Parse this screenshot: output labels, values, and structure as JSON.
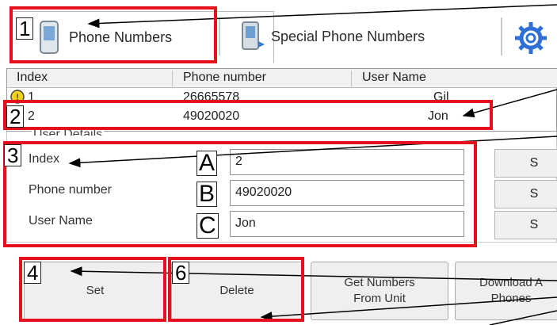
{
  "tabs": [
    {
      "label": "Phone Numbers",
      "icon": "phone-device-icon"
    },
    {
      "label": "Special Phone Numbers",
      "icon": "special-phone-icon"
    },
    {
      "label": "",
      "icon": "gear-icon"
    }
  ],
  "list": {
    "headers": [
      "Index",
      "Phone number",
      "User Name"
    ],
    "rows": [
      {
        "index": "1",
        "phone": "26665578",
        "user": "Gil",
        "icon": "warning-icon"
      },
      {
        "index": "2",
        "phone": "49020020",
        "user": "Jon"
      }
    ]
  },
  "details": {
    "title": "User Details",
    "fields": [
      {
        "label": "Index",
        "value": "2",
        "letter": "A"
      },
      {
        "label": "Phone number",
        "value": "49020020",
        "letter": "B"
      },
      {
        "label": "User Name",
        "value": "Jon",
        "letter": "C"
      }
    ],
    "side_buttons": [
      "S",
      "S",
      "S"
    ]
  },
  "buttons": {
    "set": "Set",
    "delete": "Delete",
    "get_numbers_line1": "Get Numbers",
    "get_numbers_line2": "From Unit",
    "download_line1": "Download A",
    "download_line2": "Phones"
  },
  "annotations": {
    "badges": [
      "1",
      "2",
      "3",
      "4",
      "6"
    ]
  },
  "colors": {
    "annotation": "#e5101d",
    "gear": "#2f6fd6"
  }
}
